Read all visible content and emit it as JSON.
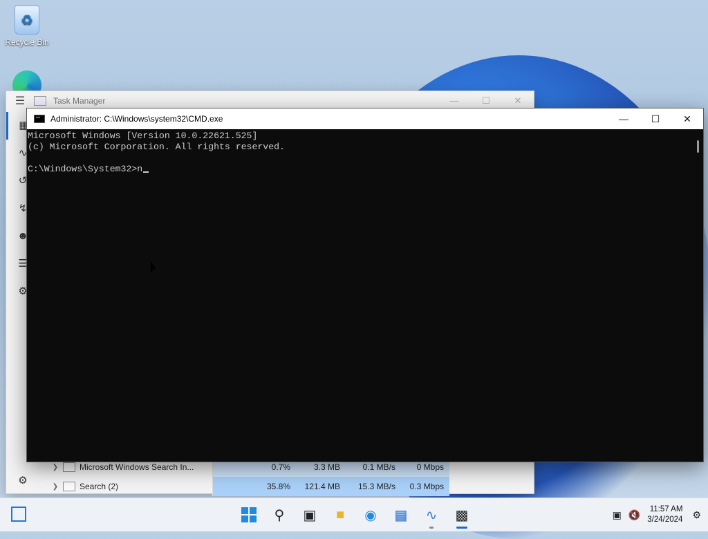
{
  "desktop": {
    "recycle_bin_label": "Recycle Bin"
  },
  "task_manager": {
    "title": "Task Manager",
    "rows": [
      {
        "name": "Microsoft Windows Search In...",
        "cpu": "0.7%",
        "memory": "3.3 MB",
        "disk": "0.1 MB/s",
        "network": "0 Mbps"
      },
      {
        "name": "Search (2)",
        "cpu": "35.8%",
        "memory": "121.4 MB",
        "disk": "15.3 MB/s",
        "network": "0.3 Mbps"
      }
    ]
  },
  "cmd": {
    "title": "Administrator: C:\\Windows\\system32\\CMD.exe",
    "lines": [
      "Microsoft Windows [Version 10.0.22621.525]",
      "(c) Microsoft Corporation. All rights reserved.",
      "",
      "C:\\Windows\\System32>n"
    ]
  },
  "taskbar": {
    "icons": [
      "start-icon",
      "search-icon",
      "task-view-icon",
      "file-explorer-icon",
      "edge-icon",
      "store-icon",
      "task-manager-icon",
      "cmd-icon"
    ],
    "time": "11:57 AM",
    "date": "3/24/2024"
  },
  "colors": {
    "accent": "#1f66d1",
    "console_bg": "#0c0c0c",
    "console_text": "#cccccc"
  }
}
